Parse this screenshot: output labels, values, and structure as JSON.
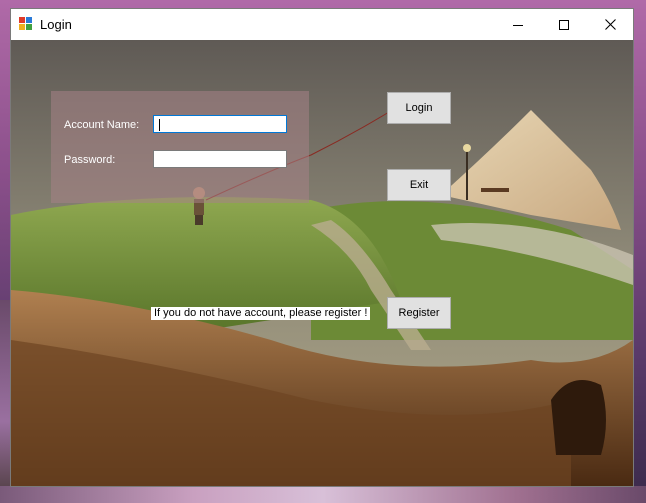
{
  "window": {
    "title": "Login"
  },
  "form": {
    "account_label": "Account Name:",
    "account_value": "",
    "password_label": "Password:",
    "password_value": ""
  },
  "buttons": {
    "login": "Login",
    "exit": "Exit",
    "register": "Register"
  },
  "hint": "If you do not have account, please register !",
  "icons": {
    "app": "app-icon",
    "minimize": "minimize-icon",
    "maximize": "maximize-icon",
    "close": "close-icon"
  }
}
